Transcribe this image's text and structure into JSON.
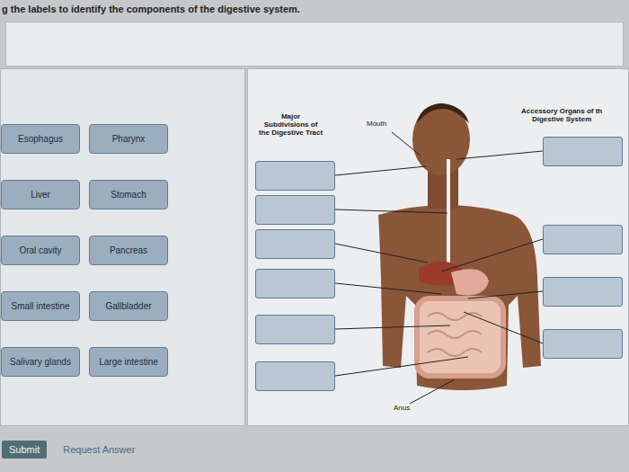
{
  "instruction": "g the labels to identify the components of the digestive system.",
  "labels": [
    {
      "text": "Esophagus"
    },
    {
      "text": "Pharynx"
    },
    {
      "text": "Liver"
    },
    {
      "text": "Stomach"
    },
    {
      "text": "Oral cavity"
    },
    {
      "text": "Pancreas"
    },
    {
      "text": "Small intestine"
    },
    {
      "text": "Gallbladder"
    },
    {
      "text": "Salivary glands"
    },
    {
      "text": "Large intestine"
    }
  ],
  "diagram": {
    "tract_heading": [
      "Major",
      "Subdivisions of",
      "the Digestive Tract"
    ],
    "accessory_heading": [
      "Accessory Organs of th",
      "Digestive System"
    ],
    "mouth_label": "Mouth",
    "anus_label": "Anus"
  },
  "buttons": {
    "submit": "Submit",
    "request": "Request Answer"
  }
}
